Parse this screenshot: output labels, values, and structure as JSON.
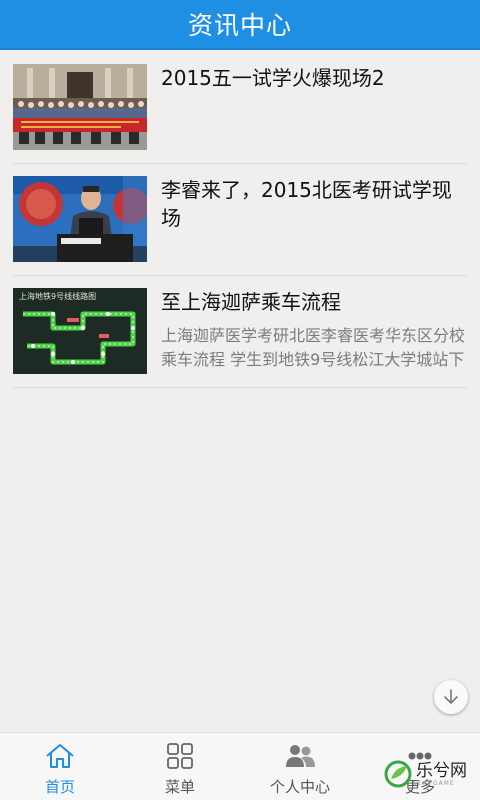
{
  "header": {
    "title": "资讯中心"
  },
  "articles": [
    {
      "title": "2015五一试学火爆现场2",
      "summary": ""
    },
    {
      "title": "李睿来了，2015北医考研试学现场",
      "summary": ""
    },
    {
      "title": "至上海迦萨乘车流程",
      "summary": "上海迦萨医学考研北医李睿医考华东区分校乘车流程 学生到地铁9号线松江大学城站下"
    }
  ],
  "thumb3_caption": "上海地铁9号线线路图",
  "tabs": [
    {
      "label": "首页",
      "icon": "home-icon",
      "active": true
    },
    {
      "label": "菜单",
      "icon": "grid-icon",
      "active": false
    },
    {
      "label": "个人中心",
      "icon": "people-icon",
      "active": false
    },
    {
      "label": "更多",
      "icon": "more-icon",
      "active": false
    }
  ],
  "watermark": {
    "text": "乐兮网",
    "sub": "LEXI GAME"
  },
  "colors": {
    "accent": "#1f8fe4",
    "background": "#f0efee"
  }
}
